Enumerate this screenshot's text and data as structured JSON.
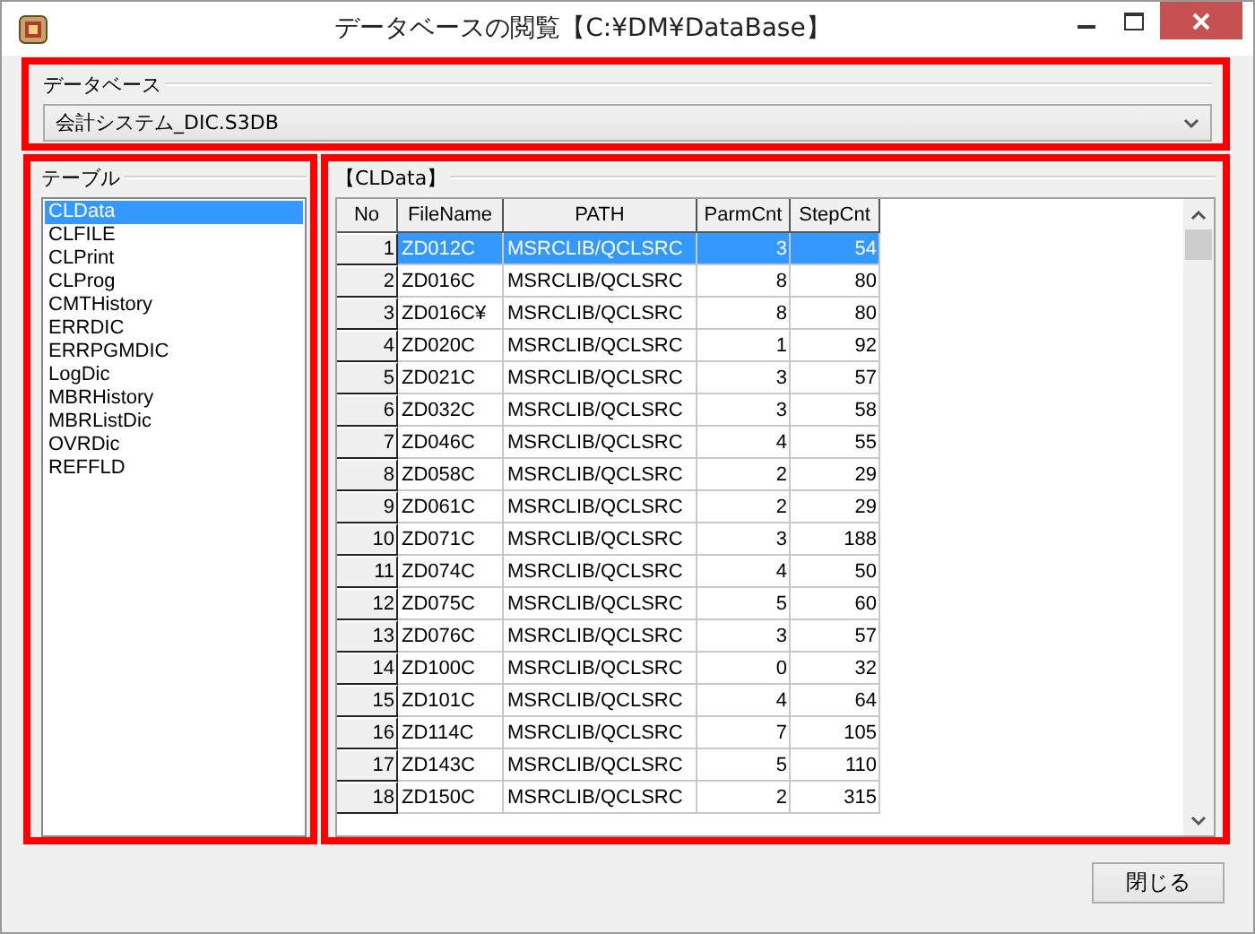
{
  "window": {
    "title": "データベースの閲覧【C:¥DM¥DataBase】"
  },
  "database": {
    "label": "データベース",
    "value": "会計システム_DIC.S3DB"
  },
  "tables": {
    "label": "テーブル",
    "items": [
      {
        "name": "CLData",
        "selected": true
      },
      {
        "name": "CLFILE",
        "selected": false
      },
      {
        "name": "CLPrint",
        "selected": false
      },
      {
        "name": "CLProg",
        "selected": false
      },
      {
        "name": "CMTHistory",
        "selected": false
      },
      {
        "name": "ERRDIC",
        "selected": false
      },
      {
        "name": "ERRPGMDIC",
        "selected": false
      },
      {
        "name": "LogDic",
        "selected": false
      },
      {
        "name": "MBRHistory",
        "selected": false
      },
      {
        "name": "MBRListDic",
        "selected": false
      },
      {
        "name": "OVRDic",
        "selected": false
      },
      {
        "name": "REFFLD",
        "selected": false
      }
    ]
  },
  "data": {
    "label": "【CLData】",
    "columns": [
      {
        "label": "No",
        "kind": "number"
      },
      {
        "label": "FileName",
        "kind": "text"
      },
      {
        "label": "PATH",
        "kind": "text"
      },
      {
        "label": "ParmCnt",
        "kind": "number"
      },
      {
        "label": "StepCnt",
        "kind": "number"
      }
    ],
    "rows": [
      {
        "cells": [
          "1",
          "ZD012C",
          "MSRCLIB/QCLSRC",
          "3",
          "54"
        ],
        "selected": true
      },
      {
        "cells": [
          "2",
          "ZD016C",
          "MSRCLIB/QCLSRC",
          "8",
          "80"
        ],
        "selected": false
      },
      {
        "cells": [
          "3",
          "ZD016C¥",
          "MSRCLIB/QCLSRC",
          "8",
          "80"
        ],
        "selected": false
      },
      {
        "cells": [
          "4",
          "ZD020C",
          "MSRCLIB/QCLSRC",
          "1",
          "92"
        ],
        "selected": false
      },
      {
        "cells": [
          "5",
          "ZD021C",
          "MSRCLIB/QCLSRC",
          "3",
          "57"
        ],
        "selected": false
      },
      {
        "cells": [
          "6",
          "ZD032C",
          "MSRCLIB/QCLSRC",
          "3",
          "58"
        ],
        "selected": false
      },
      {
        "cells": [
          "7",
          "ZD046C",
          "MSRCLIB/QCLSRC",
          "4",
          "55"
        ],
        "selected": false
      },
      {
        "cells": [
          "8",
          "ZD058C",
          "MSRCLIB/QCLSRC",
          "2",
          "29"
        ],
        "selected": false
      },
      {
        "cells": [
          "9",
          "ZD061C",
          "MSRCLIB/QCLSRC",
          "2",
          "29"
        ],
        "selected": false
      },
      {
        "cells": [
          "10",
          "ZD071C",
          "MSRCLIB/QCLSRC",
          "3",
          "188"
        ],
        "selected": false
      },
      {
        "cells": [
          "11",
          "ZD074C",
          "MSRCLIB/QCLSRC",
          "4",
          "50"
        ],
        "selected": false
      },
      {
        "cells": [
          "12",
          "ZD075C",
          "MSRCLIB/QCLSRC",
          "5",
          "60"
        ],
        "selected": false
      },
      {
        "cells": [
          "13",
          "ZD076C",
          "MSRCLIB/QCLSRC",
          "3",
          "57"
        ],
        "selected": false
      },
      {
        "cells": [
          "14",
          "ZD100C",
          "MSRCLIB/QCLSRC",
          "0",
          "32"
        ],
        "selected": false
      },
      {
        "cells": [
          "15",
          "ZD101C",
          "MSRCLIB/QCLSRC",
          "4",
          "64"
        ],
        "selected": false
      },
      {
        "cells": [
          "16",
          "ZD114C",
          "MSRCLIB/QCLSRC",
          "7",
          "105"
        ],
        "selected": false
      },
      {
        "cells": [
          "17",
          "ZD143C",
          "MSRCLIB/QCLSRC",
          "5",
          "110"
        ],
        "selected": false
      },
      {
        "cells": [
          "18",
          "ZD150C",
          "MSRCLIB/QCLSRC",
          "2",
          "315"
        ],
        "selected": false
      }
    ]
  },
  "buttons": [
    {
      "label": "閉じる"
    }
  ]
}
